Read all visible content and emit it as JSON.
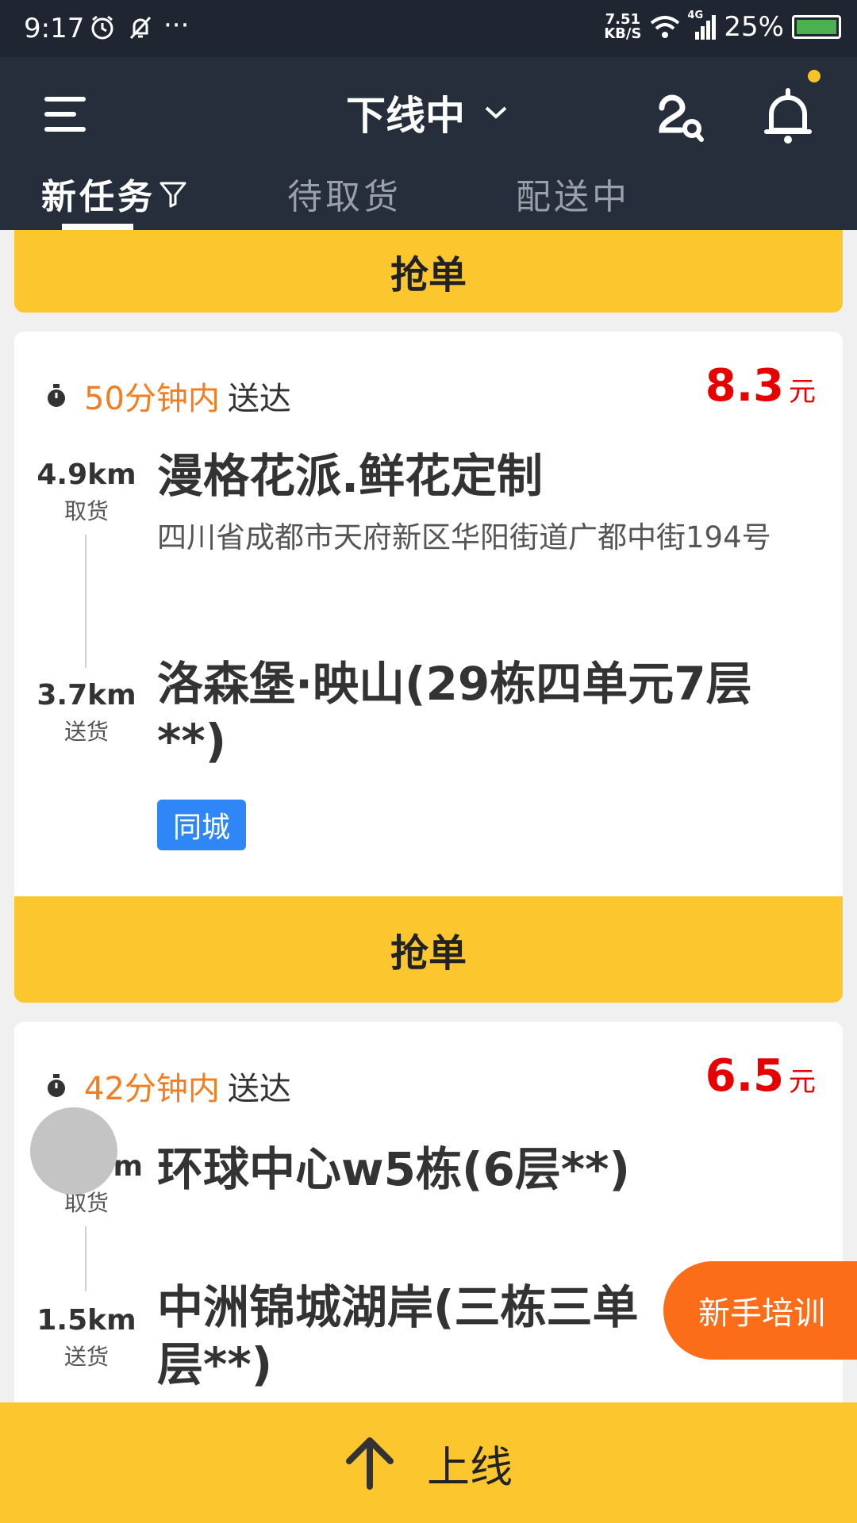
{
  "status_bar": {
    "time": "9:17",
    "more": "···",
    "net_speed_value": "7.51",
    "net_speed_unit": "KB/S",
    "network": "4G",
    "battery": "25%"
  },
  "header": {
    "status_label": "下线中",
    "tabs": [
      "新任务",
      "待取货",
      "配送中"
    ],
    "filter_icon": "filter-icon"
  },
  "prev_card": {
    "grab_label": "抢单"
  },
  "order1": {
    "time_limit": "50分钟内",
    "deliver_text": "送达",
    "price": "8.3",
    "price_unit": "元",
    "pickup_distance": "4.9km",
    "pickup_label": "取货",
    "pickup_name": "漫格花派.鲜花定制",
    "pickup_address": "四川省成都市天府新区华阳街道广都中街194号",
    "dropoff_distance": "3.7km",
    "dropoff_label": "送货",
    "dropoff_name": "洛森堡·映山(29栋四单元7层**)",
    "tag": "同城",
    "grab_label": "抢单"
  },
  "order2": {
    "time_limit": "42分钟内",
    "deliver_text": "送达",
    "price": "6.5",
    "price_unit": "元",
    "pickup_distance_visible": "m",
    "pickup_label": "取货",
    "pickup_name": "环球中心w5栋(6层**)",
    "dropoff_distance": "1.5km",
    "dropoff_label": "送货",
    "dropoff_name": "中洲锦城湖岸(三栋三单",
    "dropoff_name_line2": "层**)"
  },
  "floating": {
    "training_label": "新手培训"
  },
  "bottom_bar": {
    "online_label": "上线"
  },
  "colors": {
    "header_bg": "#262d3b",
    "accent_yellow": "#fcc72e",
    "time_orange": "#f57c1f",
    "price_red": "#e60000",
    "tag_blue": "#2f86f6",
    "training_orange": "#fb6d19"
  }
}
